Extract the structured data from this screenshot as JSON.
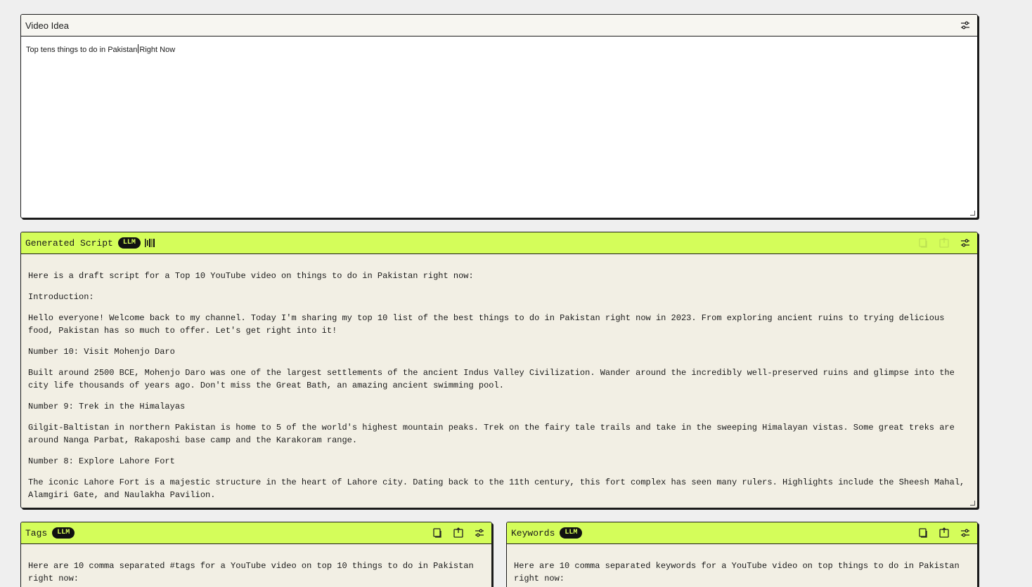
{
  "idea": {
    "title": "Video Idea",
    "text_before_caret": "Top tens things to do in Pakistan",
    "text_after_caret": "Right Now"
  },
  "script": {
    "title": "Generated Script",
    "badge": "LLM",
    "paragraphs": [
      "Here is a draft script for a Top 10 YouTube video on things to do in Pakistan right now:",
      "Introduction:",
      "Hello everyone! Welcome back to my channel. Today I'm sharing my top 10 list of the best things to do in Pakistan right now in 2023. From exploring ancient ruins to trying delicious food, Pakistan has so much to offer. Let's get right into it!",
      "Number 10: Visit Mohenjo Daro",
      "Built around 2500 BCE, Mohenjo Daro was one of the largest settlements of the ancient Indus Valley Civilization. Wander around the incredibly well-preserved ruins and glimpse into the city life thousands of years ago. Don't miss the Great Bath, an amazing ancient swimming pool.",
      "Number 9: Trek in the Himalayas",
      "Gilgit-Baltistan in northern Pakistan is home to 5 of the world's highest mountain peaks. Trek on the fairy tale trails and take in the sweeping Himalayan vistas. Some great treks are around Nanga Parbat, Rakaposhi base camp and the Karakoram range.",
      "Number 8: Explore Lahore Fort",
      "The iconic Lahore Fort is a majestic structure in the heart of Lahore city. Dating back to the 11th century, this fort complex has seen many rulers. Highlights include the Sheesh Mahal, Alamgiri Gate, and Naulakha Pavilion."
    ]
  },
  "tags": {
    "title": "Tags",
    "badge": "LLM",
    "text": "Here are 10 comma separated #tags for a YouTube video on top 10 things to do in Pakistan right now:"
  },
  "keywords": {
    "title": "Keywords",
    "badge": "LLM",
    "text": "Here are 10 comma separated keywords for a YouTube video on top things to do in Pakistan right now:"
  },
  "icons": {
    "settings": "sliders-icon",
    "copy": "copy-icon",
    "export": "export-icon",
    "barcode": "barcode-icon"
  },
  "colors": {
    "accent": "#d4fd5a",
    "badge_bg": "#111111",
    "panel_body": "#f2efe4"
  }
}
